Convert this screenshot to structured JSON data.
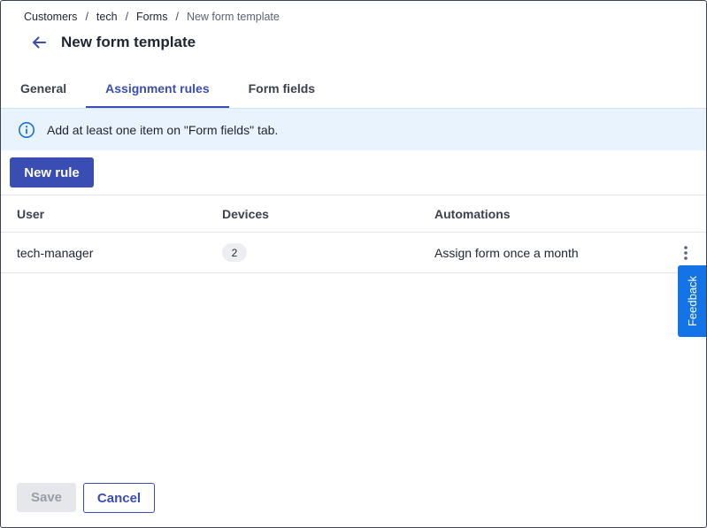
{
  "breadcrumb": {
    "items": [
      "Customers",
      "tech",
      "Forms"
    ],
    "separator": "/",
    "current": "New form template"
  },
  "header": {
    "back_icon": "arrow-left-icon",
    "title": "New form template"
  },
  "tabs": [
    {
      "label": "General",
      "active": false
    },
    {
      "label": "Assignment rules",
      "active": true
    },
    {
      "label": "Form fields",
      "active": false
    }
  ],
  "banner": {
    "icon": "info-icon",
    "text": "Add at least one item on \"Form fields\" tab."
  },
  "toolbar": {
    "new_rule_label": "New rule"
  },
  "table": {
    "columns": [
      "User",
      "Devices",
      "Automations"
    ],
    "rows": [
      {
        "user": "tech-manager",
        "devices": "2",
        "automations": "Assign form once a month"
      }
    ]
  },
  "feedback": {
    "label": "Feedback"
  },
  "footer": {
    "save_label": "Save",
    "cancel_label": "Cancel"
  },
  "colors": {
    "accent": "#3a4db3",
    "banner_bg": "#e8f3fd",
    "info_icon": "#1473e6",
    "feedback_bg": "#1473e6",
    "disabled_bg": "#e6e7ea"
  }
}
